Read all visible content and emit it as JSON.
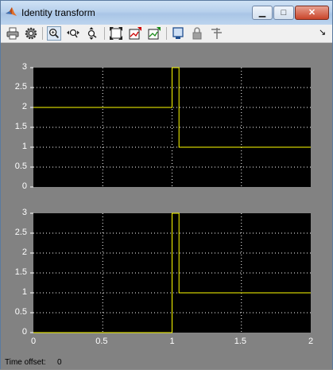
{
  "window": {
    "title": "Identity transform"
  },
  "title_buttons": {
    "minimize": "▁",
    "maximize": "□",
    "close": "✕"
  },
  "toolbar": {
    "icons": [
      "print-icon",
      "parameters-gear-icon",
      "zoom-in-icon",
      "zoom-x-icon",
      "zoom-y-icon",
      "autoscale-icon",
      "save-axes-settings-icon",
      "restore-axes-settings-icon",
      "floating-scope-icon",
      "lock-axes-icon",
      "signal-selection-icon"
    ],
    "overflow_label": "↘"
  },
  "status": {
    "label": "Time offset:",
    "value": "0"
  },
  "colors": {
    "plot_background": "#000000",
    "signal": "#ffff00",
    "grid": "#ffffff",
    "figure": "#828282"
  },
  "chart_data": [
    {
      "type": "line",
      "title": "",
      "xlabel": "",
      "ylabel": "",
      "xlim": [
        0,
        2
      ],
      "ylim": [
        0,
        3
      ],
      "grid": true,
      "yticks": [
        "0",
        "0.5",
        "1",
        "1.5",
        "2",
        "2.5",
        "3"
      ],
      "xticks": [],
      "series": [
        {
          "x": [
            0,
            1,
            1,
            1.05,
            1.05,
            2
          ],
          "y": [
            2,
            2,
            3,
            3,
            1,
            1
          ]
        }
      ]
    },
    {
      "type": "line",
      "title": "",
      "xlabel": "",
      "ylabel": "",
      "xlim": [
        0,
        2
      ],
      "ylim": [
        0,
        3
      ],
      "grid": true,
      "yticks": [
        "0",
        "0.5",
        "1",
        "1.5",
        "2",
        "2.5",
        "3"
      ],
      "xticks": [
        "0",
        "0.5",
        "1",
        "1.5",
        "2"
      ],
      "series": [
        {
          "x": [
            0,
            1,
            1,
            1.05,
            1.05,
            2
          ],
          "y": [
            0,
            0,
            3,
            3,
            1,
            1
          ]
        }
      ]
    }
  ]
}
